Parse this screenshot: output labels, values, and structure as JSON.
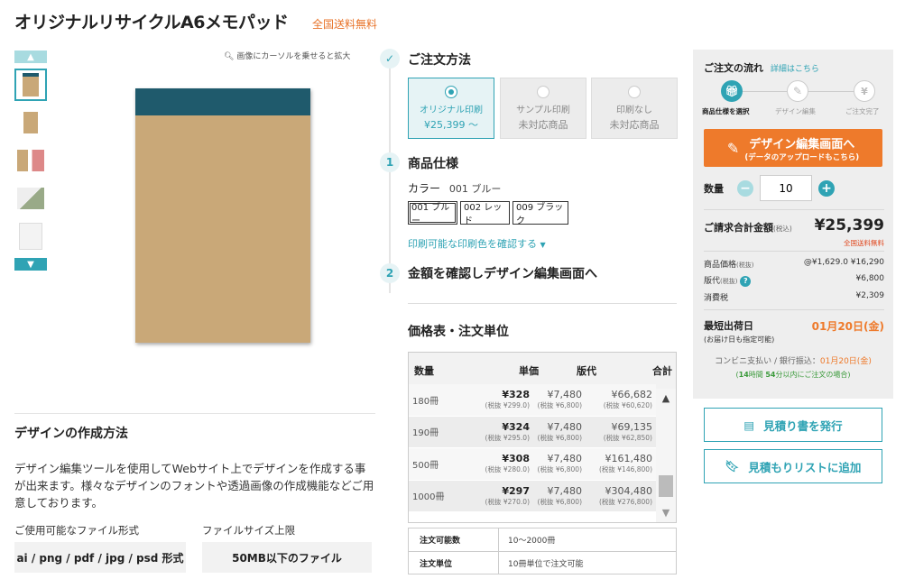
{
  "product": {
    "title": "オリジナルリサイクルA6メモパッド",
    "shipping_badge": "全国送料無料"
  },
  "gallery": {
    "zoom_hint": "画像にカーソルを乗せると拡大"
  },
  "design": {
    "heading": "デザインの作成方法",
    "description": "デザイン編集ツールを使用してWebサイト上でデザインを作成する事が出来ます。様々なデザインのフォントや透過画像の作成機能などご用意しております。",
    "formats_label": "ご使用可能なファイル形式",
    "formats_value": "ai / png / pdf / jpg / psd 形式",
    "size_label": "ファイルサイズ上限",
    "size_value": "50MB以下のファイル"
  },
  "order_method": {
    "heading": "ご注文方法",
    "options": [
      {
        "label": "オリジナル印刷",
        "sub": "¥25,399 ～"
      },
      {
        "label": "サンプル印刷",
        "sub": "未対応商品"
      },
      {
        "label": "印刷なし",
        "sub": "未対応商品"
      }
    ]
  },
  "spec": {
    "step": "1",
    "heading": "商品仕様",
    "color_label": "カラー",
    "color_value": "001 ブルー",
    "colors": [
      "001 ブルー",
      "002 レッド",
      "009 ブラック"
    ],
    "print_colors_link": "印刷可能な印刷色を確認する"
  },
  "step2": {
    "step": "2",
    "heading": "金額を確認しデザイン編集画面へ"
  },
  "price_table": {
    "heading": "価格表・注文単位",
    "headers": {
      "qty": "数量",
      "unit": "単価",
      "plate": "版代",
      "total": "合計"
    },
    "rows": [
      {
        "qty": "180冊",
        "unit": "¥328",
        "unit_sub": "(税抜 ¥299.0)",
        "plate": "¥7,480",
        "plate_sub": "(税抜 ¥6,800)",
        "total": "¥66,682",
        "total_sub": "(税抜 ¥60,620)"
      },
      {
        "qty": "190冊",
        "unit": "¥324",
        "unit_sub": "(税抜 ¥295.0)",
        "plate": "¥7,480",
        "plate_sub": "(税抜 ¥6,800)",
        "total": "¥69,135",
        "total_sub": "(税抜 ¥62,850)"
      },
      {
        "qty": "500冊",
        "unit": "¥308",
        "unit_sub": "(税抜 ¥280.0)",
        "plate": "¥7,480",
        "plate_sub": "(税抜 ¥6,800)",
        "total": "¥161,480",
        "total_sub": "(税抜 ¥146,800)"
      },
      {
        "qty": "1000冊",
        "unit": "¥297",
        "unit_sub": "(税抜 ¥270.0)",
        "plate": "¥7,480",
        "plate_sub": "(税抜 ¥6,800)",
        "total": "¥304,480",
        "total_sub": "(税抜 ¥276,800)"
      }
    ],
    "info": [
      {
        "key": "注文可能数",
        "value": "10～2000冊"
      },
      {
        "key": "注文単位",
        "value": "10冊単位で注文可能"
      }
    ]
  },
  "flow": {
    "heading": "ご注文の流れ",
    "details_link": "詳細はこちら",
    "steps": [
      "商品仕様を選択",
      "デザイン編集",
      "ご注文完了"
    ]
  },
  "order_button": {
    "label": "デザイン編集画面へ",
    "sub": "(データのアップロードもこちら)"
  },
  "quantity": {
    "label": "数量",
    "value": "10"
  },
  "summary": {
    "total_label": "ご請求合計金額",
    "total_tax_note": "(税込)",
    "total_value": "¥25,399",
    "shipping": "全国送料無料",
    "lines": [
      {
        "label": "商品価格",
        "note": "(税抜)",
        "value": "@¥1,629.0 ¥16,290"
      },
      {
        "label": "版代",
        "note": "(税抜)",
        "value": "¥6,800"
      },
      {
        "label": "消費税",
        "note": "",
        "value": "¥2,309"
      }
    ],
    "ship_label": "最短出荷日",
    "ship_note": "(お届け日も指定可能)",
    "ship_date": "01月20日(金)",
    "payment_text": "コンビニ支払い / 銀行振込：",
    "payment_date": "01月20日(金)",
    "deadline_prefix": "(",
    "deadline_hours": "14",
    "deadline_h_unit": "時間",
    "deadline_mins": "54",
    "deadline_suffix": "分以内にご注文の場合)"
  },
  "side_buttons": {
    "estimate": "見積り書を発行",
    "wishlist": "見積もりリストに追加"
  },
  "colors": {
    "accent": "#2fa3b4",
    "orange": "#ee7a2b",
    "red": "#e0451b"
  }
}
